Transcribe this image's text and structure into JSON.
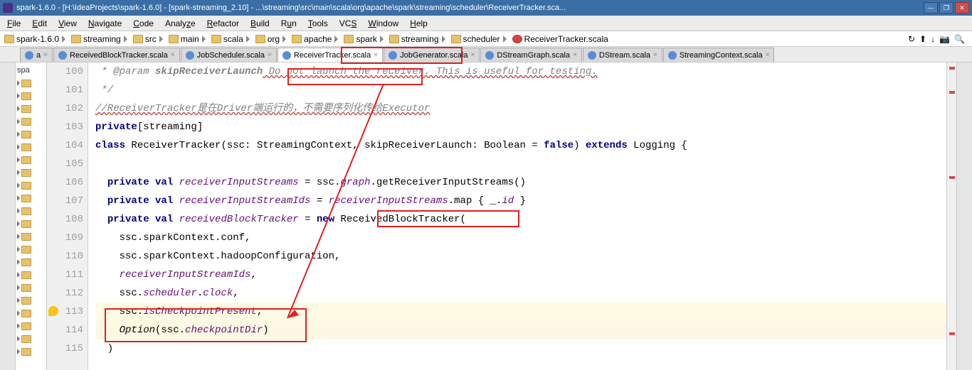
{
  "window": {
    "title": "spark-1.6.0 - [H:\\IdeaProjects\\spark-1.6.0] - [spark-streaming_2.10] - ...\\streaming\\src\\main\\scala\\org\\apache\\spark\\streaming\\scheduler\\ReceiverTracker.sca..."
  },
  "menu": {
    "file": "File",
    "edit": "Edit",
    "view": "View",
    "navigate": "Navigate",
    "code": "Code",
    "analyze": "Analyze",
    "refactor": "Refactor",
    "build": "Build",
    "run": "Run",
    "tools": "Tools",
    "vcs": "VCS",
    "window": "Window",
    "help": "Help"
  },
  "breadcrumbs": [
    "spark-1.6.0",
    "streaming",
    "src",
    "main",
    "scala",
    "org",
    "apache",
    "spark",
    "streaming",
    "scheduler",
    "ReceiverTracker.scala"
  ],
  "tabs": [
    {
      "label": "a",
      "close": "×",
      "icon": "scala"
    },
    {
      "label": "ReceivedBlockTracker.scala",
      "close": "×",
      "icon": "scala"
    },
    {
      "label": "JobScheduler.scala",
      "close": "×",
      "icon": "scala"
    },
    {
      "label": "ReceiverTracker.scala",
      "close": "×",
      "icon": "scala",
      "active": true
    },
    {
      "label": "JobGenerator.scala",
      "close": "×",
      "icon": "scala"
    },
    {
      "label": "DStreamGraph.scala",
      "close": "×",
      "icon": "scala"
    },
    {
      "label": "DStream.scala",
      "close": "×",
      "icon": "scala"
    },
    {
      "label": "StreamingContext.scala",
      "close": "×",
      "icon": "scala"
    }
  ],
  "project_label": "spa",
  "line_numbers": [
    "100",
    "101",
    "102",
    "103",
    "104",
    "105",
    "106",
    "107",
    "108",
    "109",
    "110",
    "111",
    "112",
    "113",
    "114",
    "115"
  ],
  "code": {
    "l100_a": " * @param ",
    "l100_b": "skipReceiverLaunch",
    "l100_c": " Do not launch the receiver. This is useful for testing.",
    "l101": " */",
    "l102": "//ReceiverTracker是在Driver端运行的，不需要序列化传给Executor",
    "l103_a": "private",
    "l103_b": "[streaming]",
    "l104_a": "class",
    "l104_b": " ReceiverTracker(ssc: StreamingContext, skipReceiverLaunch: Boolean = ",
    "l104_c": "false",
    "l104_d": ") ",
    "l104_e": "extends",
    "l104_f": " Logging {",
    "l106_a": "  ",
    "l106_b": "private val",
    "l106_c": " ",
    "l106_d": "receiverInputStreams",
    "l106_e": " = ssc.",
    "l106_f": "graph",
    "l106_g": ".getReceiverInputStreams()",
    "l107_a": "  ",
    "l107_b": "private val",
    "l107_c": " ",
    "l107_d": "receiverInputStreamIds",
    "l107_e": " = ",
    "l107_f": "receiverInputStreams",
    "l107_g": ".map { _.",
    "l107_h": "id",
    "l107_i": " }",
    "l108_a": "  ",
    "l108_b": "private val",
    "l108_c": " ",
    "l108_d": "receivedBlockTracker",
    "l108_e": " = ",
    "l108_f": "new",
    "l108_g": " ReceivedBlockTracker(",
    "l109": "    ssc.sparkContext.conf,",
    "l110": "    ssc.sparkContext.hadoopConfiguration,",
    "l111_a": "    ",
    "l111_b": "receiverInputStreamIds",
    "l111_c": ",",
    "l112_a": "    ssc.",
    "l112_b": "scheduler",
    "l112_c": ".",
    "l112_d": "clock",
    "l112_e": ",",
    "l113_a": "    ssc.",
    "l113_b": "isCheckpointPresent",
    "l113_c": ",",
    "l114_a": "    ",
    "l114_b": "Option",
    "l114_c": "(ssc.",
    "l114_d": "checkpointDir",
    "l114_e": ")",
    "l115": "  )"
  }
}
